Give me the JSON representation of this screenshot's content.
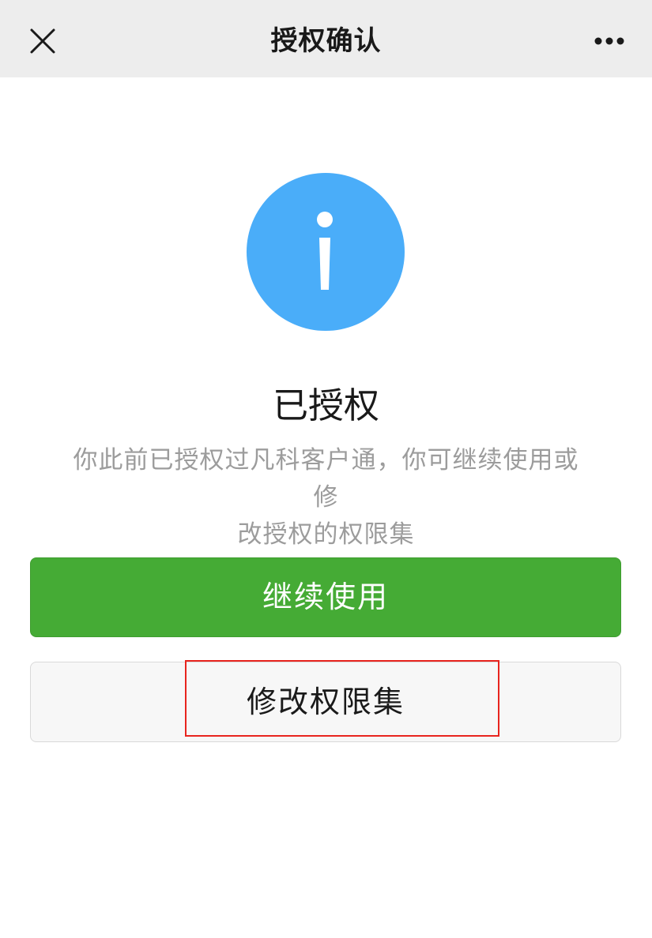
{
  "navbar": {
    "title": "授权确认",
    "close_icon": "close-icon",
    "more_icon": "more-dots-icon"
  },
  "status": {
    "icon": "info-icon",
    "icon_color": "#4aadf9",
    "title": "已授权",
    "description_line1": "你此前已授权过凡科客户通，你可继续使用或修",
    "description_line2": "改授权的权限集"
  },
  "actions": {
    "continue_label": "继续使用",
    "continue_color": "#45ab35",
    "modify_label": "修改权限集",
    "highlight_color": "#e8241e"
  }
}
